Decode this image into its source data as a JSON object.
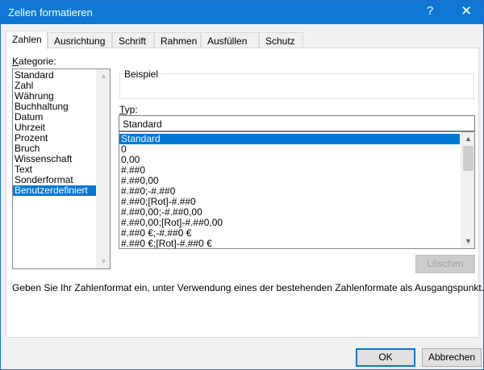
{
  "window": {
    "title": "Zellen formatieren",
    "help_glyph": "?",
    "close_glyph": "✕"
  },
  "tabs": [
    {
      "label": "Zahlen",
      "active": true
    },
    {
      "label": "Ausrichtung",
      "active": false
    },
    {
      "label": "Schrift",
      "active": false
    },
    {
      "label": "Rahmen",
      "active": false
    },
    {
      "label": "Ausfüllen",
      "active": false
    },
    {
      "label": "Schutz",
      "active": false
    }
  ],
  "kategorie": {
    "label_accel": "K",
    "label_rest": "ategorie:",
    "items": [
      "Standard",
      "Zahl",
      "Währung",
      "Buchhaltung",
      "Datum",
      "Uhrzeit",
      "Prozent",
      "Bruch",
      "Wissenschaft",
      "Text",
      "Sonderformat",
      "Benutzerdefiniert"
    ],
    "selected_index": 11
  },
  "beispiel": {
    "title": "Beispiel",
    "value": ""
  },
  "typ": {
    "label_accel": "T",
    "label_rest": "yp:",
    "value": "Standard",
    "items": [
      "Standard",
      "0",
      "0,00",
      "#.##0",
      "#.##0,00",
      "#.##0;-#.##0",
      "#.##0;[Rot]-#.##0",
      "#.##0,00;-#.##0,00",
      "#.##0,00;[Rot]-#.##0,00",
      "#.##0 €;-#.##0 €",
      "#.##0 €;[Rot]-#.##0 €"
    ],
    "selected_index": 0
  },
  "buttons": {
    "loeschen": "Löschen",
    "ok": "OK",
    "abbrechen": "Abbrechen"
  },
  "hint": "Geben Sie Ihr Zahlenformat ein, unter Verwendung eines der bestehenden Zahlenformate als Ausgangspunkt."
}
